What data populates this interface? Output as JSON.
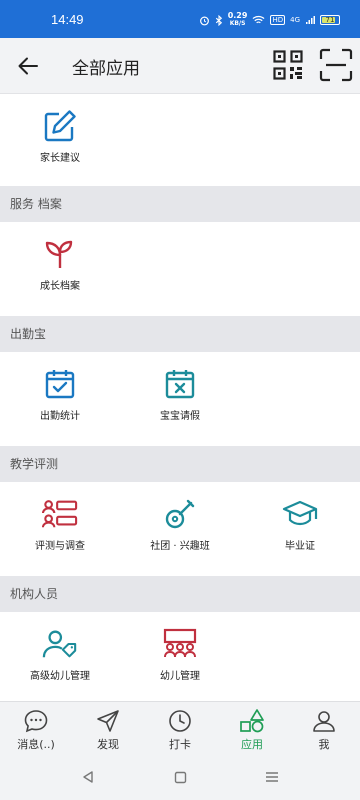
{
  "status": {
    "time": "14:49",
    "net_speed": "0.29",
    "net_unit": "KB/S",
    "hd": "HD",
    "signal": "4G",
    "battery": "71"
  },
  "header": {
    "title": "全部应用"
  },
  "sections": [
    {
      "title": "",
      "items": [
        {
          "label": "家长建议",
          "icon": "edit-icon"
        }
      ]
    },
    {
      "title": "服务 档案",
      "items": [
        {
          "label": "成长档案",
          "icon": "sprout-icon"
        }
      ]
    },
    {
      "title": "出勤宝",
      "items": [
        {
          "label": "出勤统计",
          "icon": "calendar-check-icon"
        },
        {
          "label": "宝宝请假",
          "icon": "calendar-x-icon"
        }
      ]
    },
    {
      "title": "教学评测",
      "items": [
        {
          "label": "评测与调查",
          "icon": "users-list-icon"
        },
        {
          "label": "社团 · 兴趣班",
          "icon": "guitar-icon"
        },
        {
          "label": "毕业证",
          "icon": "graduation-cap-icon"
        }
      ]
    },
    {
      "title": "机构人员",
      "items": [
        {
          "label": "高级幼儿管理",
          "icon": "user-tag-icon"
        },
        {
          "label": "幼儿管理",
          "icon": "classroom-icon"
        }
      ]
    }
  ],
  "tabs": [
    {
      "label": "消息(..)",
      "icon": "chat-icon"
    },
    {
      "label": "发现",
      "icon": "navigation-icon"
    },
    {
      "label": "打卡",
      "icon": "clock-icon"
    },
    {
      "label": "应用",
      "icon": "shapes-icon",
      "active": true
    },
    {
      "label": "我",
      "icon": "user-icon"
    }
  ],
  "colors": {
    "status_bar": "#1f6fd6",
    "icon_blue": "#1a78c2",
    "icon_red": "#c0303f",
    "icon_teal": "#1c8c9a",
    "active_tab": "#1f9d55"
  }
}
